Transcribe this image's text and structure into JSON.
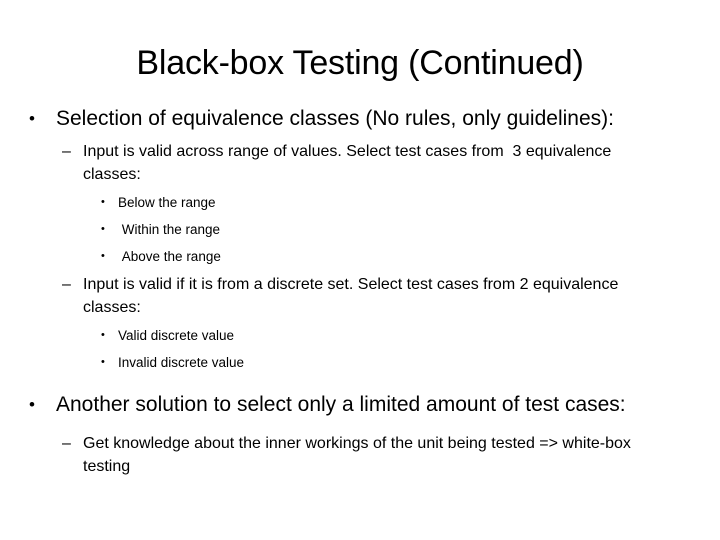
{
  "slide": {
    "title": "Black-box Testing (Continued)",
    "background_color": "#ffffff",
    "text_color": "#000000",
    "markers": {
      "level1": "•",
      "level2": "–",
      "level3": "•"
    },
    "bullets": [
      {
        "level": 1,
        "text": "Selection of equivalence classes (No rules, only guidelines):"
      },
      {
        "level": 2,
        "text": "Input is valid across range of values. Select test cases from  3 equivalence classes:"
      },
      {
        "level": 3,
        "text": "Below the range"
      },
      {
        "level": 3,
        "text": " Within the range"
      },
      {
        "level": 3,
        "text": " Above the range"
      },
      {
        "level": 2,
        "text": "Input is valid if it is from a discrete set. Select test cases from 2 equivalence classes:"
      },
      {
        "level": 3,
        "text": "Valid discrete value"
      },
      {
        "level": 3,
        "text": "Invalid discrete value"
      },
      {
        "level": 1,
        "text": "Another solution to select only a limited amount of test cases:"
      },
      {
        "level": 2,
        "text": "Get knowledge about the inner workings of the unit being tested => white-box testing"
      }
    ]
  }
}
